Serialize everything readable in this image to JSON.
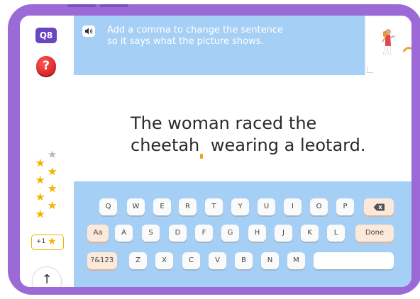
{
  "question": {
    "number": "Q8"
  },
  "sidebar": {
    "help_label": "?",
    "stars": {
      "earned": 7,
      "total": 8
    },
    "bonus": {
      "label": "+1"
    },
    "up_label": "↑"
  },
  "instruction": {
    "speaker_label": "🔈",
    "line1": "Add a comma to change the sentence",
    "line2": "so it says what the picture shows."
  },
  "sentence": {
    "line1": "The woman raced the",
    "line2_before": "cheetah",
    "line2_after": " wearing a leotard."
  },
  "keyboard": {
    "row1": [
      "Q",
      "W",
      "E",
      "R",
      "T",
      "Y",
      "U",
      "I",
      "O",
      "P"
    ],
    "backspace": "⌫",
    "row2_lead": "Aa",
    "row2": [
      "A",
      "S",
      "D",
      "F",
      "G",
      "H",
      "J",
      "K",
      "L"
    ],
    "done_label": "Done",
    "row3_lead": "?&123",
    "row3": [
      "Z",
      "X",
      "C",
      "V",
      "B",
      "N",
      "M"
    ]
  },
  "colors": {
    "frame": "#9b6ad6",
    "panel": "#a6cff5",
    "accent": "#f4b400"
  }
}
